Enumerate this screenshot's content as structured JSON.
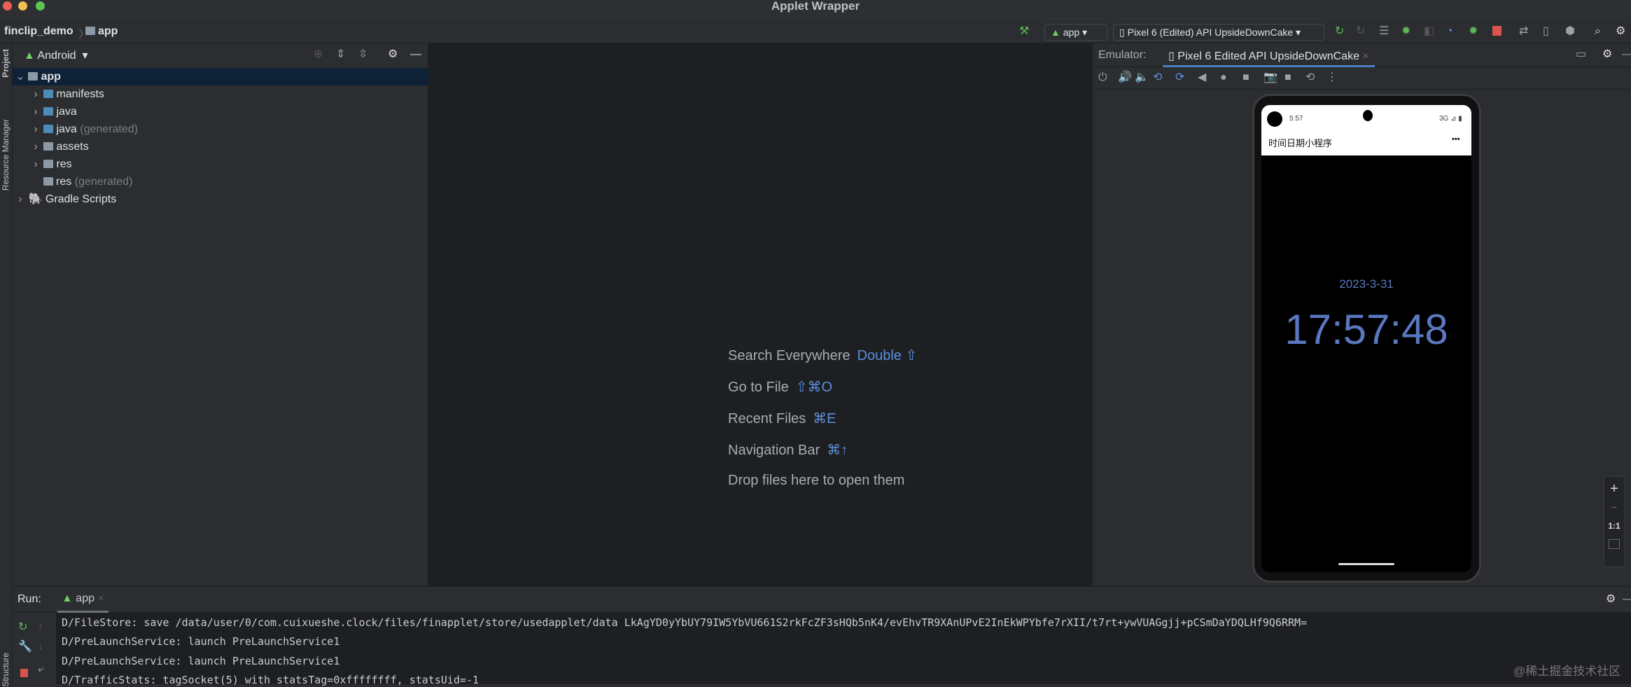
{
  "window": {
    "title": "Applet Wrapper"
  },
  "breadcrumb": {
    "project": "finclip_demo",
    "module": "app"
  },
  "toolbar": {
    "run_config": "app",
    "device": "Pixel 6 (Edited) API UpsideDownCake"
  },
  "side_tabs": {
    "project": "Project",
    "resource_manager": "Resource Manager",
    "structure": "Structure"
  },
  "project_panel": {
    "view": "Android",
    "tree": [
      {
        "label": "app",
        "suffix": "",
        "level": 0,
        "expanded": true,
        "selected": true
      },
      {
        "label": "manifests",
        "suffix": "",
        "level": 1
      },
      {
        "label": "java",
        "suffix": "",
        "level": 1
      },
      {
        "label": "java",
        "suffix": "(generated)",
        "level": 1
      },
      {
        "label": "assets",
        "suffix": "",
        "level": 1
      },
      {
        "label": "res",
        "suffix": "",
        "level": 1
      },
      {
        "label": "res",
        "suffix": "(generated)",
        "level": 1,
        "leaf": true
      },
      {
        "label": "Gradle Scripts",
        "suffix": "",
        "level": 0
      }
    ]
  },
  "editor": {
    "hints": [
      {
        "label": "Search Everywhere",
        "key": "Double ⇧"
      },
      {
        "label": "Go to File",
        "key": "⇧⌘O"
      },
      {
        "label": "Recent Files",
        "key": "⌘E"
      },
      {
        "label": "Navigation Bar",
        "key": "⌘↑"
      },
      {
        "label": "Drop files here to open them",
        "key": ""
      }
    ]
  },
  "emulator": {
    "label": "Emulator:",
    "tab": "Pixel 6 Edited API UpsideDownCake",
    "phone": {
      "status_time": "5:57",
      "status_right": "3G ⊿ ▮",
      "app_title": "时间日期小程序",
      "menu": "•••",
      "date": "2023-3-31",
      "time": "17:57:48"
    },
    "zoom": {
      "plus": "+",
      "minus": "−",
      "actual": "1:1"
    }
  },
  "run": {
    "label": "Run:",
    "tab": "app",
    "log": [
      "D/FileStore: save /data/user/0/com.cuixueshe.clock/files/finapplet/store/usedapplet/data LkAgYD0yYbUY79IW5YbVU661S2rkFcZF3sHQb5nK4/evEhvTR9XAnUPvE2InEkWPYbfe7rXII/t7rt+ywVUAGgjj+pCSmDaYDQLHf9Q6RRM=",
      "D/PreLaunchService: launch PreLaunchService1",
      "D/PreLaunchService: launch PreLaunchService1",
      "D/TrafficStats: tagSocket(5) with statsTag=0xffffffff, statsUid=-1"
    ]
  },
  "watermark": "@稀土掘金技术社区",
  "colors": {
    "accent": "#5c8fe0",
    "clock": "#5a78c0",
    "selection": "#0e2137"
  }
}
